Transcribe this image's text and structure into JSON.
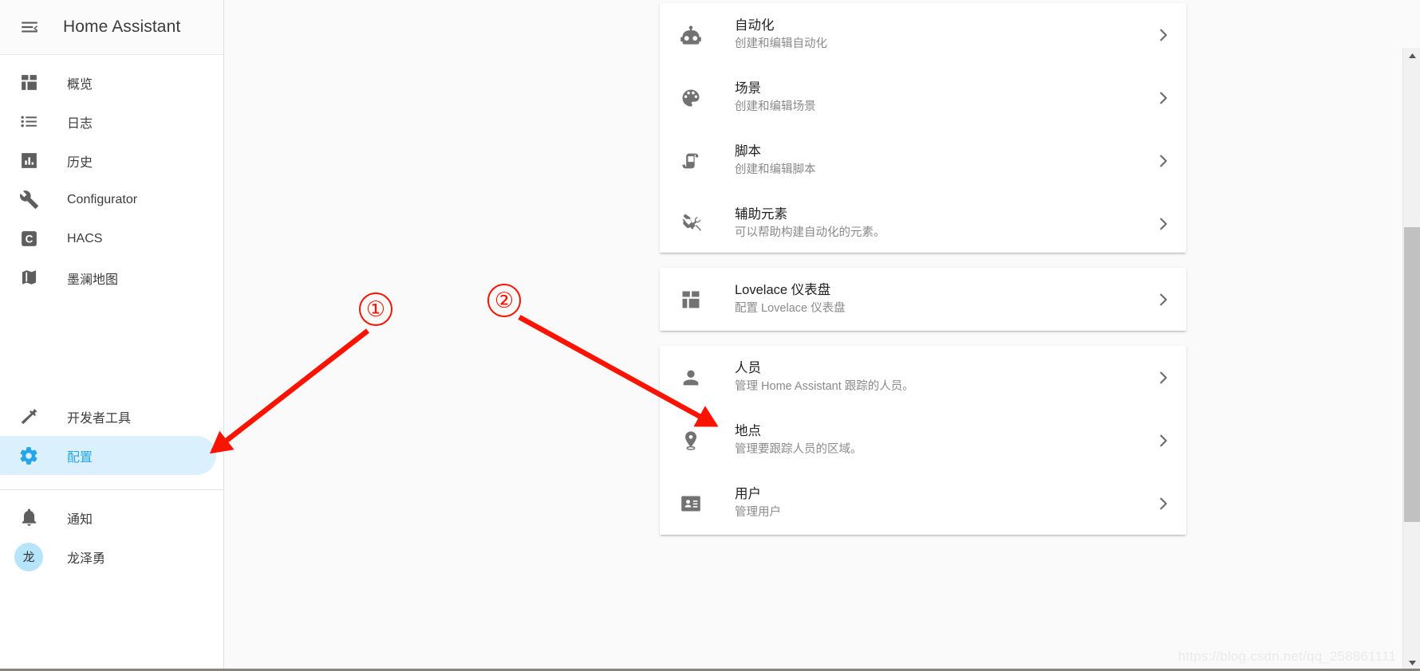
{
  "sidebar": {
    "menu_icon": "menu-collapse-icon",
    "title": "Home Assistant",
    "items": [
      {
        "label": "概览",
        "icon": "view-dashboard-icon",
        "active": false
      },
      {
        "label": "日志",
        "icon": "format-list-bulleted-icon",
        "active": false
      },
      {
        "label": "历史",
        "icon": "chart-box-icon",
        "active": false
      },
      {
        "label": "Configurator",
        "icon": "wrench-icon",
        "active": false
      },
      {
        "label": "HACS",
        "icon": "hacs-c-icon",
        "active": false
      },
      {
        "label": "墨澜地图",
        "icon": "map-icon",
        "active": false
      }
    ],
    "tools": [
      {
        "label": "开发者工具",
        "icon": "hammer-icon",
        "active": false
      },
      {
        "label": "配置",
        "icon": "cog-icon",
        "active": true
      }
    ],
    "bottom": [
      {
        "label": "通知",
        "icon": "bell-icon"
      }
    ],
    "user": {
      "name": "龙泽勇",
      "avatar_initial": "龙"
    }
  },
  "main": {
    "cards": [
      {
        "name": "automation-card",
        "rows": [
          {
            "title": "自动化",
            "subtitle": "创建和编辑自动化",
            "icon": "robot-icon",
            "chevron": "chevron-right-icon"
          },
          {
            "title": "场景",
            "subtitle": "创建和编辑场景",
            "icon": "palette-icon",
            "chevron": "chevron-right-icon"
          },
          {
            "title": "脚本",
            "subtitle": "创建和编辑脚本",
            "icon": "script-icon",
            "chevron": "chevron-right-icon"
          },
          {
            "title": "辅助元素",
            "subtitle": "可以帮助构建自动化的元素。",
            "icon": "tools-icon",
            "chevron": "chevron-right-icon"
          }
        ]
      },
      {
        "name": "lovelace-card",
        "rows": [
          {
            "title": "Lovelace 仪表盘",
            "subtitle": "配置 Lovelace 仪表盘",
            "icon": "view-dashboard-icon",
            "chevron": "chevron-right-icon"
          }
        ]
      },
      {
        "name": "people-card",
        "rows": [
          {
            "title": "人员",
            "subtitle": "管理 Home Assistant 跟踪的人员。",
            "icon": "account-icon",
            "chevron": "chevron-right-icon"
          },
          {
            "title": "地点",
            "subtitle": "管理要跟踪人员的区域。",
            "icon": "map-marker-icon",
            "chevron": "chevron-right-icon"
          },
          {
            "title": "用户",
            "subtitle": "管理用户",
            "icon": "account-card-icon",
            "chevron": "chevron-right-icon"
          }
        ]
      }
    ]
  },
  "annotations": {
    "marker_one": "①",
    "marker_two": "②",
    "color": "#fa1400"
  },
  "scrollbar": {
    "up_arrow": "triangle-up-icon",
    "down_arrow": "triangle-down-icon",
    "thumb": "scroll-thumb"
  },
  "watermark": {
    "text": "https://blog.csdn.net/qq_258861111"
  },
  "colors": {
    "accent": "#27a5e8",
    "active_bg": "#daf0fc",
    "avatar_bg": "#b6e4fa",
    "canvas": "#fafafa",
    "card": "#ffffff",
    "icon": "#727272",
    "title_text": "#212121",
    "sub_text": "#8a8a8a"
  }
}
